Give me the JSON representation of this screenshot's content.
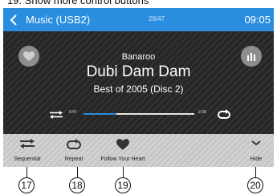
{
  "caption": "19. Show more control buttons",
  "status_bar": {
    "source_title": "Music (USB2)",
    "track_counter": "28/47",
    "clock": "09:05"
  },
  "now_playing": {
    "artist": "Banaroo",
    "song": "Dubi Dam Dam",
    "album": "Best of 2005 (Disc 2)",
    "elapsed": "0:47",
    "total": "2:38",
    "progress_fraction": 0.3
  },
  "bottom_bar": {
    "sequential": "Sequential",
    "repeat": "Repeat",
    "follow": "Follow Your Heart",
    "hide": "Hide"
  },
  "callouts": [
    "17",
    "18",
    "19",
    "20"
  ],
  "colors": {
    "accent": "#2a8de0",
    "screen_bg": "#2c2c2c",
    "bottom_bar": "#cfcfcf"
  }
}
